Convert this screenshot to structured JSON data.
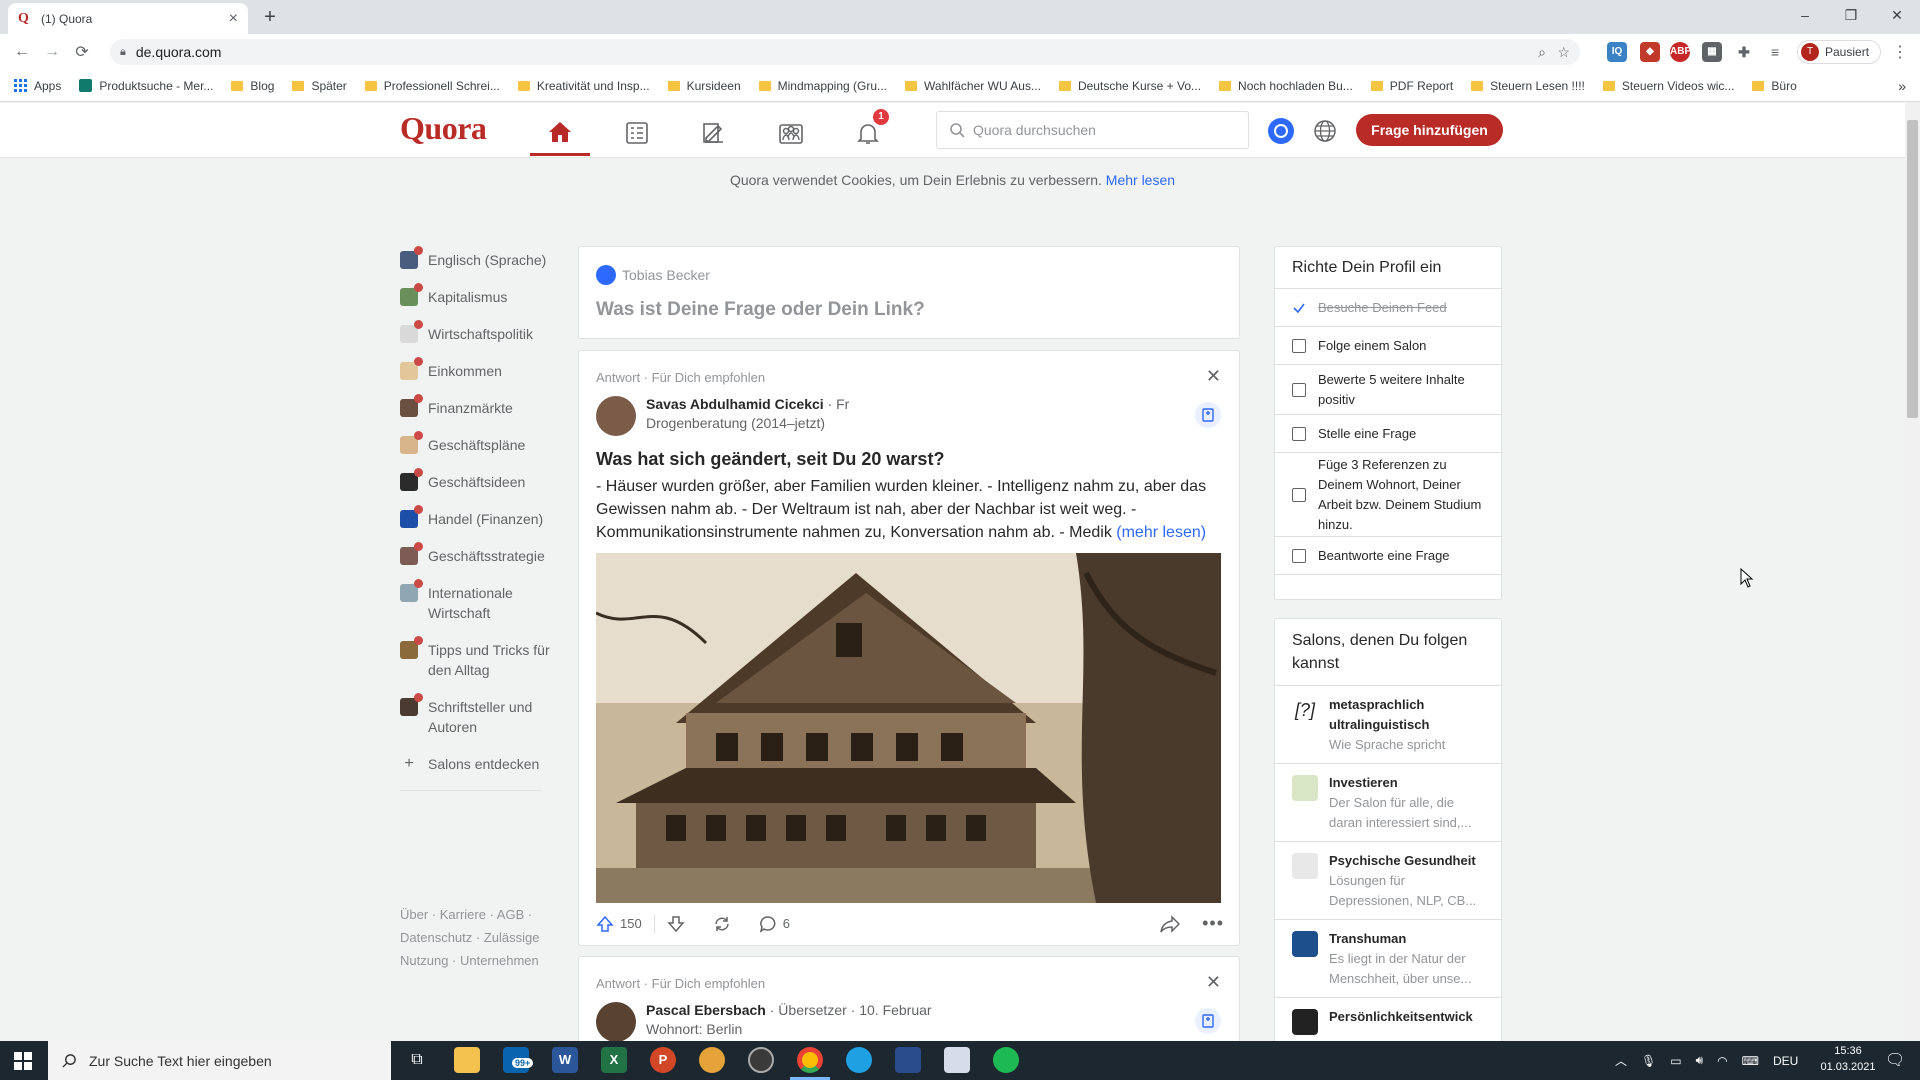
{
  "browser": {
    "tab_title": "(1) Quora",
    "url": "de.quora.com",
    "profile_label": "Pausiert",
    "profile_initial": "T",
    "bookmarks": [
      {
        "label": "Apps"
      },
      {
        "label": "Produktsuche - Mer..."
      },
      {
        "label": "Blog"
      },
      {
        "label": "Später"
      },
      {
        "label": "Professionell Schrei..."
      },
      {
        "label": "Kreativität und Insp..."
      },
      {
        "label": "Kursideen"
      },
      {
        "label": "Mindmapping (Gru..."
      },
      {
        "label": "Wahlfächer WU Aus..."
      },
      {
        "label": "Deutsche Kurse + Vo..."
      },
      {
        "label": "Noch hochladen Bu..."
      },
      {
        "label": "PDF Report"
      },
      {
        "label": "Steuern Lesen !!!!"
      },
      {
        "label": "Steuern Videos wic..."
      },
      {
        "label": "Büro"
      }
    ]
  },
  "header": {
    "logo": "Quora",
    "notification_count": "1",
    "search_placeholder": "Quora durchsuchen",
    "add_question": "Frage hinzufügen"
  },
  "cookie_notice": {
    "text": "Quora verwendet Cookies, um Dein Erlebnis zu verbessern.",
    "link": "Mehr lesen"
  },
  "sidebar": {
    "topics": [
      {
        "label": "Englisch (Sprache)",
        "color": "#4a5d7e"
      },
      {
        "label": "Kapitalismus",
        "color": "#6b8f5a"
      },
      {
        "label": "Wirtschaftspolitik",
        "color": "#d9d9d9"
      },
      {
        "label": "Einkommen",
        "color": "#e2c79a"
      },
      {
        "label": "Finanzmärkte",
        "color": "#6a5040"
      },
      {
        "label": "Geschäftspläne",
        "color": "#d8b48a"
      },
      {
        "label": "Geschäftsideen",
        "color": "#2b2b2b"
      },
      {
        "label": "Handel (Finanzen)",
        "color": "#1d4fa8"
      },
      {
        "label": "Geschäftsstrategie",
        "color": "#7d5c56"
      },
      {
        "label": "Internationale Wirtschaft",
        "color": "#8fa7b3"
      },
      {
        "label": "Tipps und Tricks für den Alltag",
        "color": "#8a6a3a"
      },
      {
        "label": "Schriftsteller und Autoren",
        "color": "#4a3a30"
      }
    ],
    "discover": "Salons entdecken",
    "footer": "Über · Karriere · AGB · Datenschutz · Zulässige Nutzung · Unternehmen"
  },
  "ask": {
    "user": "Tobias Becker",
    "prompt": "Was ist Deine Frage oder Dein Link?"
  },
  "posts": [
    {
      "meta": "Antwort · Für Dich empfohlen",
      "author": "Savas Abdulhamid Cicekci",
      "author_suffix": " · Fr",
      "credential": "Drogenberatung (2014–jetzt)",
      "title": "Was hat sich geändert, seit Du 20 warst?",
      "excerpt": "- Häuser wurden größer, aber Familien wurden kleiner. - Intelligenz nahm zu, aber das Gewissen nahm ab. - Der Weltraum ist nah, aber der Nachbar ist weit weg. - Kommunikationsinstrumente nahmen zu, Konversation nahm ab. - Medik",
      "more": "(mehr lesen)",
      "upvotes": "150",
      "comments": "6"
    },
    {
      "meta": "Antwort · Für Dich empfohlen",
      "author": "Pascal Ebersbach",
      "author_suffix": " · Übersetzer · 10. Februar",
      "credential": "Wohnort: Berlin"
    }
  ],
  "profile_setup": {
    "title": "Richte Dein Profil ein",
    "items": [
      {
        "label": "Besuche Deinen Feed",
        "done": true
      },
      {
        "label": "Folge einem Salon",
        "done": false
      },
      {
        "label": "Bewerte 5 weitere Inhalte positiv",
        "done": false
      },
      {
        "label": "Stelle eine Frage",
        "done": false
      },
      {
        "label": "Füge 3 Referenzen zu Deinem Wohnort, Deiner Arbeit bzw. Deinem Studium hinzu.",
        "done": false
      },
      {
        "label": "Beantworte eine Frage",
        "done": false
      }
    ]
  },
  "salons": {
    "title": "Salons, denen Du folgen kannst",
    "items": [
      {
        "name": "metasprachlich ultralinguistisch",
        "desc": "Wie Sprache spricht",
        "icon": "[?]"
      },
      {
        "name": "Investieren",
        "desc": "Der Salon für alle, die daran interessiert sind,...",
        "icon": ""
      },
      {
        "name": "Psychische Gesundheit",
        "desc": "Lösungen für Depressionen, NLP, CB...",
        "icon": ""
      },
      {
        "name": "Transhuman",
        "desc": "Es liegt in der Natur der Menschheit, über unse...",
        "icon": ""
      },
      {
        "name": "Persönlichkeitsentwick",
        "desc": "",
        "icon": ""
      }
    ]
  },
  "taskbar": {
    "search_placeholder": "Zur Suche Text hier eingeben",
    "mail_badge": "99+",
    "lang": "DEU",
    "time": "15:36",
    "date": "01.03.2021"
  }
}
